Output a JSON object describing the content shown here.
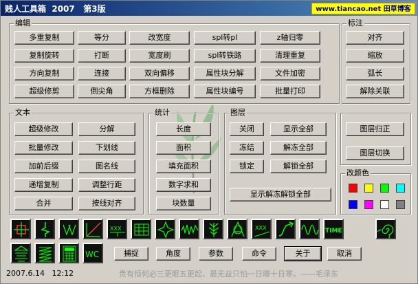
{
  "window": {
    "title": "贱人工具箱  2007   第3版",
    "site_banner": "www.tiancao.net 田草博客"
  },
  "groups": {
    "edit": "编辑",
    "annotate": "标注",
    "text": "文本",
    "stats": "统计",
    "layer": "图层",
    "color": "改颜色"
  },
  "edit_buttons": [
    [
      "多重复制",
      "等分",
      "改宽度",
      "spl转pl",
      "z轴归零"
    ],
    [
      "复制旋转",
      "打断",
      "宽度刷",
      "spl转铁路",
      "清理重复"
    ],
    [
      "方向复制",
      "连接",
      "双向偏移",
      "属性块分解",
      "文件加密"
    ],
    [
      "超级修剪",
      "倒尖角",
      "方框删除",
      "属性块编号",
      "批量打印"
    ]
  ],
  "annotate_buttons": [
    "对齐",
    "缩放",
    "弧长",
    "解除关联"
  ],
  "text_buttons": [
    [
      "超级修改",
      "分解"
    ],
    [
      "批量修改",
      "下划线"
    ],
    [
      "加前后缀",
      "图名线"
    ],
    [
      "递增复制",
      "调整行距"
    ],
    [
      "合并",
      "按线对齐"
    ]
  ],
  "stats_buttons": [
    "长度",
    "面积",
    "填充面积",
    "数字求和",
    "块数量"
  ],
  "layer_buttons": [
    [
      "关闭",
      "显示全部"
    ],
    [
      "冻结",
      "解冻全部"
    ],
    [
      "锁定",
      "解锁全部"
    ]
  ],
  "layer_show_all": "显示解冻解锁全部",
  "layer_side_buttons": [
    "图层归正",
    "图层切换"
  ],
  "colors": [
    "#ff0000",
    "#ffff00",
    "#00ff00",
    "#00ffff",
    "#0000ff",
    "#ff00ff",
    "#ffffff",
    "#808080"
  ],
  "icon_names": [
    "crosshair",
    "zigzag-break",
    "triangle-marks",
    "diagonal-line",
    "xxx-label",
    "grid-table",
    "star-shape",
    "wave-line",
    "branch-shape",
    "a-triangle",
    "xxx-slant",
    "curve-arrow",
    "sine-wave",
    "time-text",
    "spiral",
    "stacked-lines",
    "zigzag-spring",
    "calculator",
    "wc-text"
  ],
  "icon_texts": {
    "xxx": "XXX",
    "time": "TIME",
    "wc": "WC",
    "a": "A"
  },
  "bottom_buttons": [
    "捕捉",
    "角度",
    "参数",
    "命令",
    "关于",
    "取消"
  ],
  "status": {
    "date": "2007.6.14   12:12",
    "quote": "贵有恒何必三更眠五更起，最无益只怕一日曝十日寒。——毛泽东"
  }
}
